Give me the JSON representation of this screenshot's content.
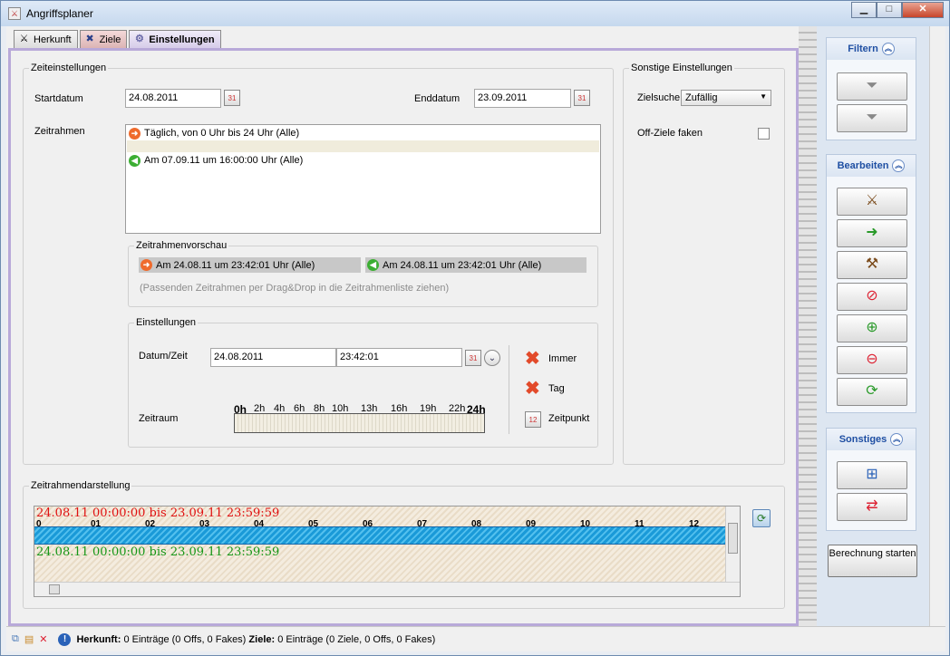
{
  "window": {
    "title": "Angriffsplaner",
    "btn_min": "▁",
    "btn_max": "□",
    "btn_close": "✕"
  },
  "tabs": [
    {
      "label": "Herkunft",
      "icon": "swords-icon"
    },
    {
      "label": "Ziele",
      "icon": "target-icon"
    },
    {
      "label": "Einstellungen",
      "icon": "gear-icon"
    }
  ],
  "zeiteinstellungen": {
    "group_label": "Zeiteinstellungen",
    "startdatum_label": "Startdatum",
    "startdatum": "24.08.2011",
    "enddatum_label": "Enddatum",
    "enddatum": "23.09.2011",
    "zeitrahmen_label": "Zeitrahmen",
    "zeitrahmen_items": [
      "Täglich, von 0 Uhr bis 24 Uhr (Alle)",
      "Am 07.09.11 um 16:00:00 Uhr (Alle)"
    ],
    "vorschau_label": "Zeitrahmenvorschau",
    "vorschau_items": [
      "Am 24.08.11 um 23:42:01 Uhr (Alle)",
      "Am 24.08.11 um 23:42:01 Uhr (Alle)"
    ],
    "vorschau_hint": "(Passenden Zeitrahmen per Drag&Drop in die Zeitrahmenliste ziehen)",
    "einstellungen_label": "Einstellungen",
    "datumzeit_label": "Datum/Zeit",
    "datum": "24.08.2011",
    "zeit": "23:42:01",
    "zeitraum_label": "Zeitraum",
    "scale_ticks": [
      "0h",
      "2h",
      "4h",
      "6h",
      "8h",
      "10h",
      "13h",
      "16h",
      "19h",
      "22h",
      "24h"
    ],
    "btn_immer": "Immer",
    "btn_tag": "Tag",
    "btn_zeitpunkt": "Zeitpunkt"
  },
  "sonstige": {
    "group_label": "Sonstige Einstellungen",
    "zielsuche_label": "Zielsuche",
    "zielsuche_value": "Zufällig",
    "offziele_label": "Off-Ziele faken",
    "offziele_checked": false
  },
  "darstellung": {
    "group_label": "Zeitrahmendarstellung",
    "range_red": "24.08.11 00:00:00 bis 23.09.11 23:59:59",
    "range_green": "24.08.11 00:00:00 bis 23.09.11 23:59:59",
    "hours": [
      "0",
      "01",
      "02",
      "03",
      "04",
      "05",
      "06",
      "07",
      "08",
      "09",
      "10",
      "11",
      "12"
    ]
  },
  "side": {
    "filtern": {
      "label": "Filtern",
      "buttons": [
        "filter-remove-icon",
        "filter-icon"
      ]
    },
    "bearbeiten": {
      "label": "Bearbeiten",
      "buttons": [
        "attack-all-icon",
        "village-move-icon",
        "attack-icon",
        "no-attack-icon",
        "add-unit-icon",
        "remove-unit-icon",
        "refresh-unit-icon"
      ]
    },
    "sonstiges": {
      "label": "Sonstiges",
      "buttons": [
        "structure-icon",
        "swap-icon"
      ]
    },
    "calc_button": "Berechnung starten"
  },
  "status": {
    "herkunft_label": "Herkunft:",
    "herkunft_value": "0 Einträge (0 Offs, 0 Fakes)",
    "ziele_label": "Ziele:",
    "ziele_value": "0 Einträge (0 Ziele, 0 Offs, 0 Fakes)"
  }
}
